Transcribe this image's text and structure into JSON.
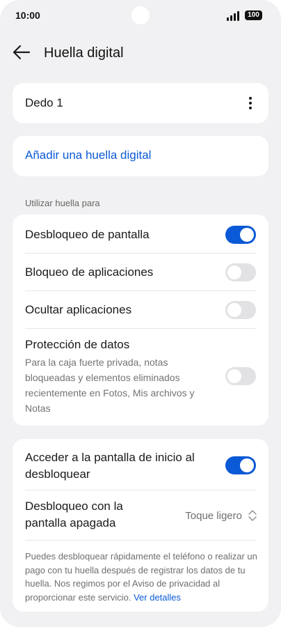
{
  "status_bar": {
    "time": "10:00",
    "battery": "100"
  },
  "header": {
    "back_icon": "arrow-left-icon",
    "title": "Huella digital"
  },
  "finger_card": {
    "label": "Dedo 1",
    "more_icon": "more-vertical-icon"
  },
  "add_fingerprint": {
    "label": "Añadir una huella digital"
  },
  "use_section": {
    "label": "Utilizar huella para",
    "items": [
      {
        "title": "Desbloqueo de pantalla",
        "enabled": true
      },
      {
        "title": "Bloqueo de aplicaciones",
        "enabled": false
      },
      {
        "title": "Ocultar aplicaciones",
        "enabled": false
      },
      {
        "title": "Protección de datos",
        "subtitle": "Para la caja fuerte privada, notas bloqueadas y elementos eliminados recientemente en Fotos, Mis archivos y Notas",
        "enabled": false
      }
    ]
  },
  "unlock_section": {
    "home_screen": {
      "title": "Acceder a la pantalla de inicio al desbloquear",
      "enabled": true
    },
    "screen_off": {
      "title": "Desbloqueo con la pantalla apagada",
      "value": "Toque ligero",
      "icon": "chevron-up-down-icon"
    },
    "note": "Puedes desbloquear rápidamente el teléfono o realizar un pago con tu huella después de registrar los datos de tu huella. Nos regimos por el Aviso de privacidad al proporcionar este servicio.",
    "note_link": "Ver detalles"
  },
  "colors": {
    "accent": "#0a59d6",
    "background": "#f1f1f3",
    "card": "#ffffff",
    "toggle_off": "#e2e2e5"
  }
}
